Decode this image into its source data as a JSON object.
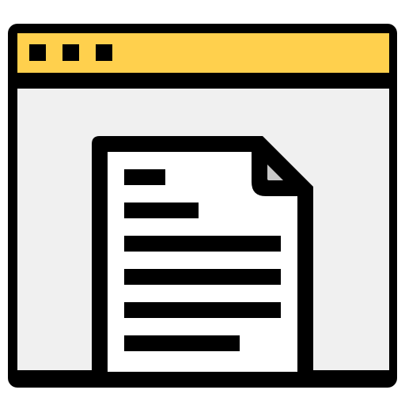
{
  "icon": {
    "name": "browser-window-document-icon",
    "window": {
      "titlebar_dots": 3,
      "colors": {
        "outline": "#000000",
        "titlebar": "#FFD04D",
        "content": "#F0F0F0"
      }
    },
    "document": {
      "text_lines": 6,
      "colors": {
        "page": "#FFFFFF",
        "folded_corner": "#C8C8C8",
        "lines": "#000000"
      }
    }
  }
}
